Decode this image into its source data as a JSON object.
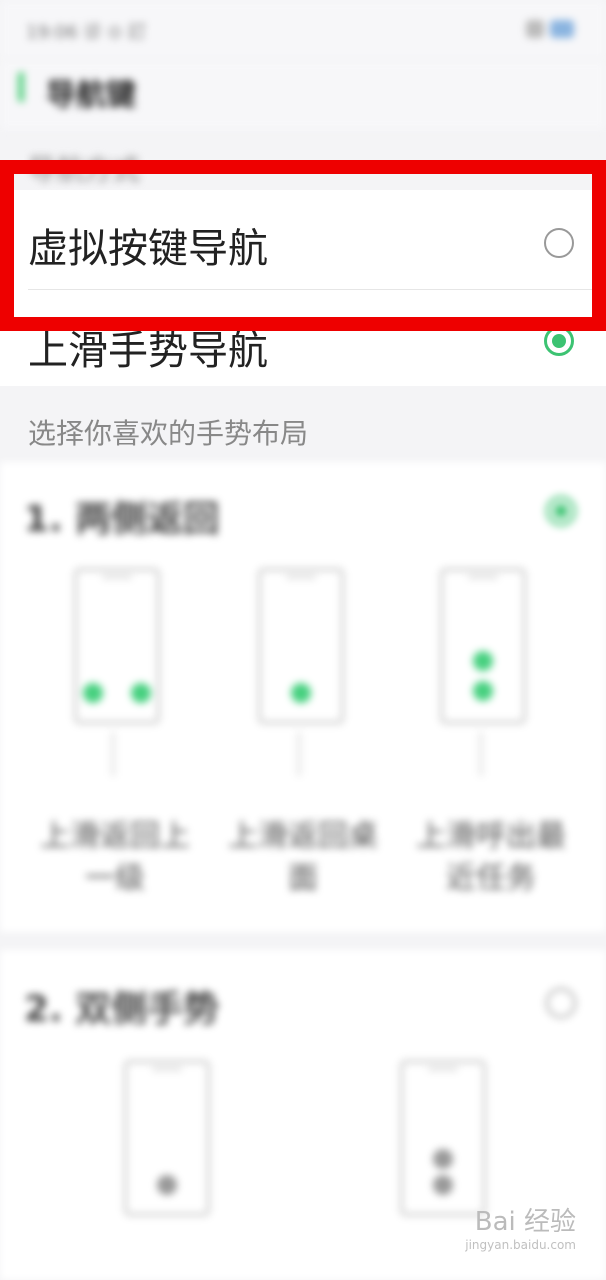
{
  "status_bar": {
    "time": "19:06 诊 ⊙ 訂"
  },
  "app_bar": {
    "title": "导航键"
  },
  "nav_section": {
    "label": "导航方式",
    "options": [
      {
        "label": "虚拟按键导航",
        "selected": false
      },
      {
        "label": "上滑手势导航",
        "selected": true
      }
    ]
  },
  "layout_section": {
    "label": "选择你喜欢的手势布局",
    "layouts": [
      {
        "title": "1. 两侧返回",
        "selected": true,
        "captions": [
          "上滑返回上一级",
          "上滑返回桌面",
          "上滑呼出最近任务"
        ]
      },
      {
        "title": "2. 双侧手势",
        "selected": false
      }
    ]
  },
  "watermark": {
    "brand": "Bai 经验",
    "url": "jingyan.baidu.com"
  },
  "colors": {
    "accent": "#3cc372",
    "highlight": "#ee0000"
  }
}
